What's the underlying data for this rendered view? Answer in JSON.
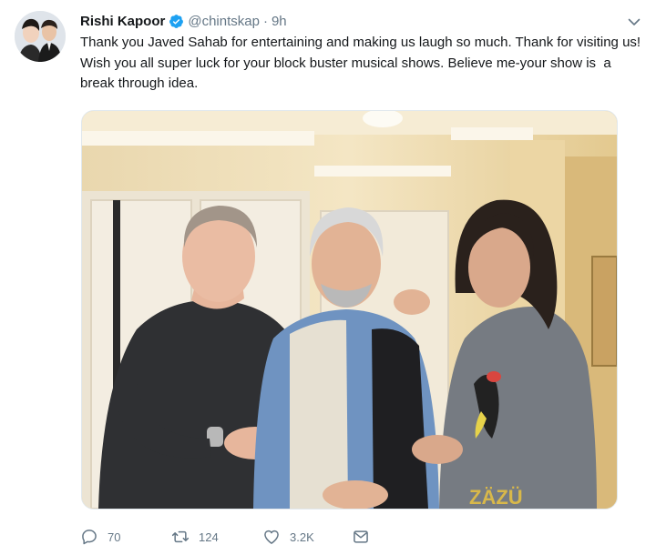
{
  "tweet": {
    "display_name": "Rishi Kapoor",
    "handle": "@chintskap",
    "separator": "·",
    "time": "9h",
    "text": "Thank you Javed Sahab for entertaining and making us laugh so much. Thank for visiting us! Wish you all super luck for your block buster musical shows. Believe me-your show is  a break through idea.",
    "photo_sweater_text": "ZÄZÜ"
  },
  "actions": {
    "reply_count": "70",
    "retweet_count": "124",
    "like_count": "3.2K"
  },
  "icons": {
    "avatar": "profile-avatar",
    "verified": "verified-badge-icon",
    "caret": "chevron-down-icon",
    "reply": "reply-icon",
    "retweet": "retweet-icon",
    "like": "heart-icon",
    "message": "envelope-icon"
  },
  "colors": {
    "text": "#14171a",
    "secondary": "#657786",
    "verified": "#1da1f2"
  }
}
